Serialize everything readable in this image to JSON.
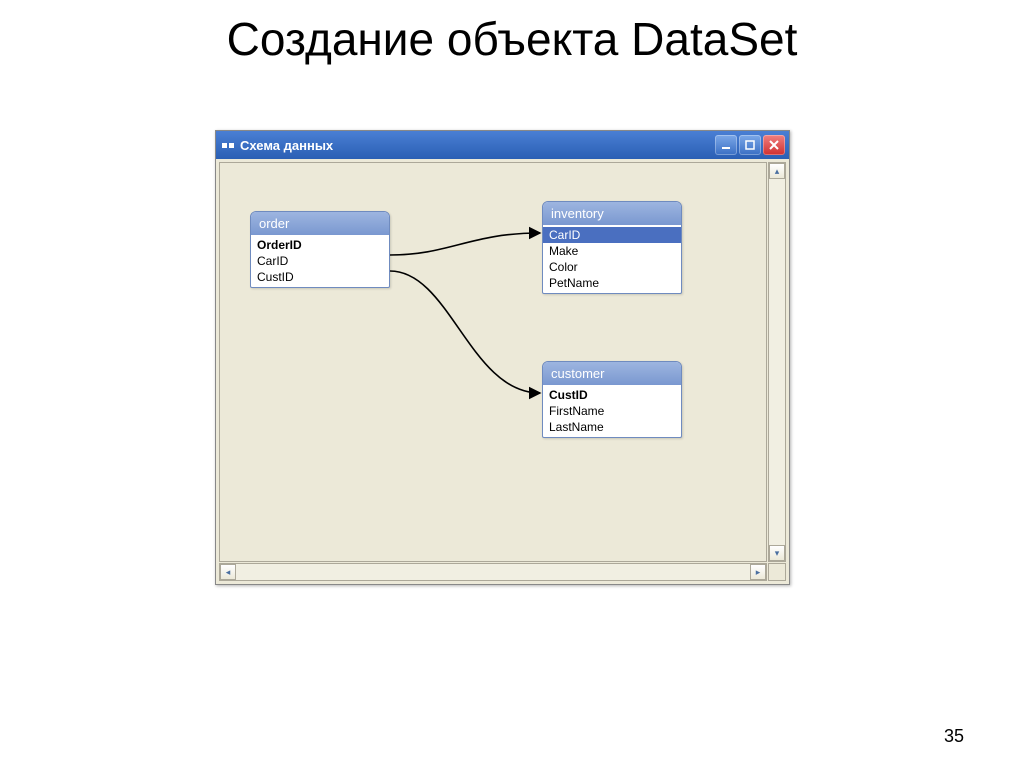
{
  "slide": {
    "title": "Создание объекта DataSet",
    "page_number": "35"
  },
  "window": {
    "title": "Схема данных"
  },
  "tables": {
    "order": {
      "name": "order",
      "fields": [
        "OrderID",
        "CarID",
        "CustID"
      ]
    },
    "inventory": {
      "name": "inventory",
      "fields": [
        "CarID",
        "Make",
        "Color",
        "PetName"
      ]
    },
    "customer": {
      "name": "customer",
      "fields": [
        "CustID",
        "FirstName",
        "LastName"
      ]
    }
  }
}
